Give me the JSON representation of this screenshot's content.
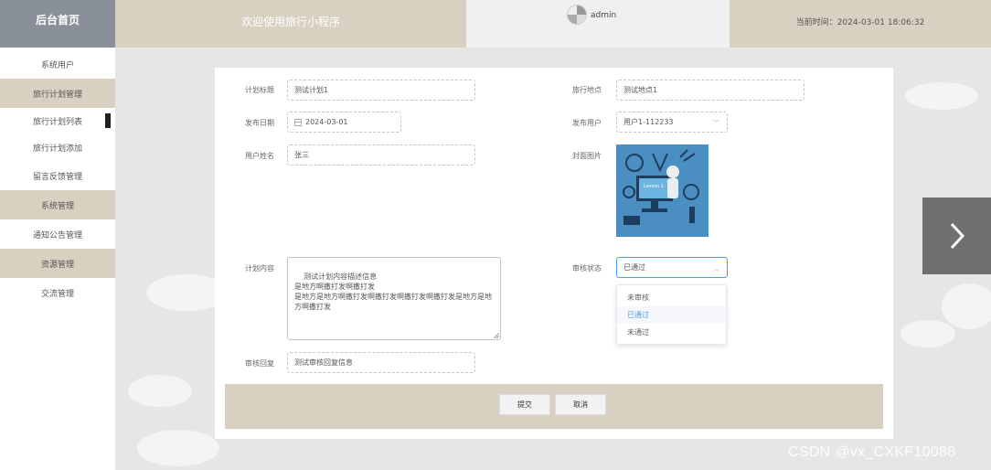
{
  "header": {
    "logo_text": "后台首页",
    "welcome_text": "欢迎使用旅行小程序",
    "username": "admin",
    "current_time_label": "当前时间：2024-03-01 18:06:32"
  },
  "sidebar": {
    "items": [
      {
        "label": "系统用户",
        "type": "item"
      },
      {
        "label": "旅行计划管理",
        "type": "group"
      },
      {
        "label": "旅行计划列表",
        "type": "sub",
        "active": true
      },
      {
        "label": "旅行计划添加",
        "type": "sub"
      },
      {
        "label": "留言反馈管理",
        "type": "item"
      },
      {
        "label": "系统管理",
        "type": "group"
      },
      {
        "label": "通知公告管理",
        "type": "item"
      },
      {
        "label": "资源管理",
        "type": "group"
      },
      {
        "label": "交流管理",
        "type": "item"
      }
    ]
  },
  "form": {
    "plan_title": {
      "label": "计划标题",
      "value": "测试计划1"
    },
    "travel_location": {
      "label": "旅行地点",
      "value": "测试地点1"
    },
    "publish_date": {
      "label": "发布日期",
      "value": "2024-03-01"
    },
    "publish_user": {
      "label": "发布用户",
      "value": "用户1-112233"
    },
    "user_name": {
      "label": "用户姓名",
      "value": "张三"
    },
    "cover_image": {
      "label": "封面图片",
      "caption": "Lesson 1"
    },
    "plan_content": {
      "label": "计划内容",
      "value": "测试计划内容描述信息\n是地方啊撒打发啊撒打发\n是地方是地方啊撒打发啊撒打发啊撒打发啊撒打发是地方是地方啊撒打发"
    },
    "review_status": {
      "label": "审核状态",
      "value": "已通过",
      "options": [
        "未审核",
        "已通过",
        "未通过"
      ],
      "selected_index": 1
    },
    "review_reply": {
      "label": "审核回复",
      "value": "测试审核回复信息"
    }
  },
  "actions": {
    "submit_label": "提交",
    "cancel_label": "取消"
  },
  "watermark": "CSDN @vx_CXKF10088",
  "colors": {
    "accent": "#409eff",
    "beige": "#d8d0c0",
    "logo_bg": "#8a9099"
  }
}
